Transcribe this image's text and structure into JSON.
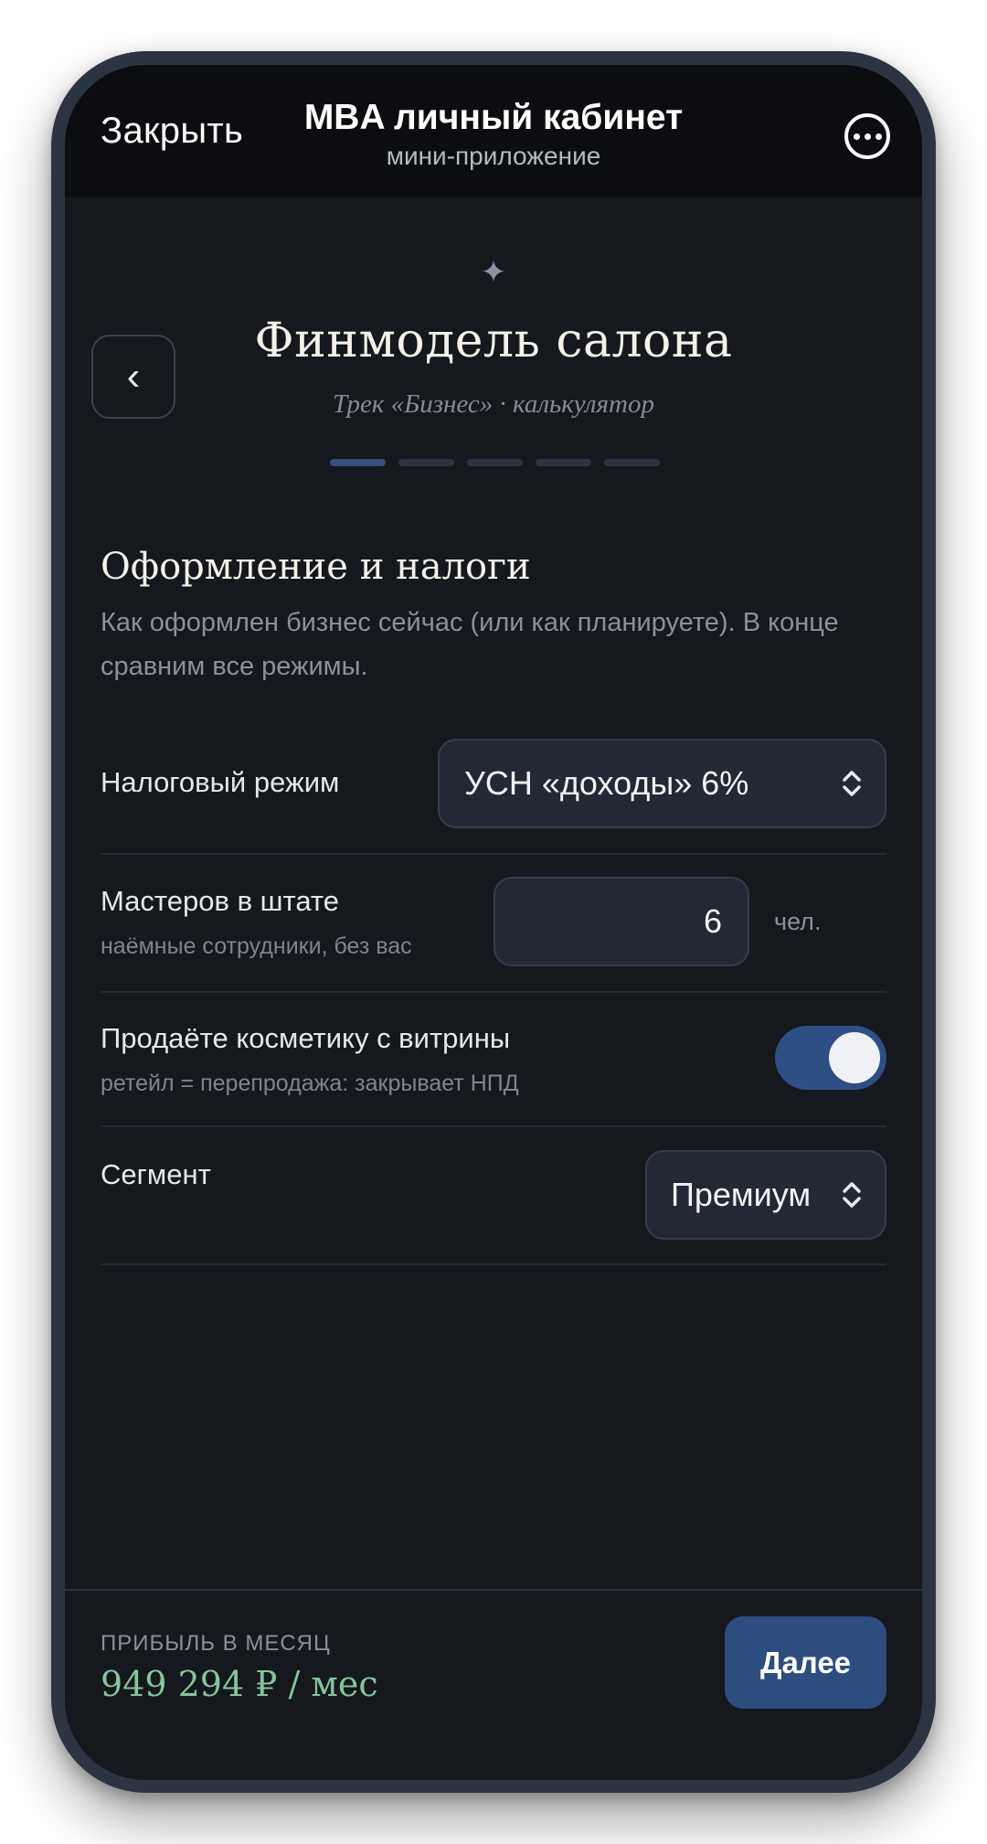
{
  "appbar": {
    "close_label": "Закрыть",
    "title": "MBA личный кабинет",
    "subtitle": "мини-приложение",
    "more_icon": "more-horizontal-circle-icon"
  },
  "header": {
    "sparkle_icon": "sparkle-icon",
    "back_icon": "chevron-left-icon",
    "back_glyph": "‹",
    "title": "Финмодель салона",
    "subtitle": "Трек «Бизнес» · калькулятор",
    "steps_total": 5,
    "steps_current": 1
  },
  "section": {
    "title": "Оформление и налоги",
    "description": "Как оформлен бизнес сейчас (или как планируете). В конце сравним все режимы."
  },
  "fields": {
    "tax_mode": {
      "label": "Налоговый режим",
      "value": "УСН «доходы» 6%"
    },
    "masters": {
      "label": "Мастеров в штате",
      "hint": "наёмные сотрудники, без вас",
      "value": "6",
      "unit": "чел."
    },
    "retail": {
      "label": "Продаёте косметику с витрины",
      "hint": "ретейл = перепродажа: закрывает НПД",
      "enabled": true
    },
    "segment": {
      "label": "Сегмент",
      "value": "Премиум"
    }
  },
  "footer": {
    "profit_label": "ПРИБЫЛЬ В МЕСЯЦ",
    "profit_value": "949 294 ₽ / мес",
    "next_label": "Далее"
  },
  "colors": {
    "accent": "#2d4d7f",
    "background": "#15181d",
    "profit": "#86c49b"
  }
}
